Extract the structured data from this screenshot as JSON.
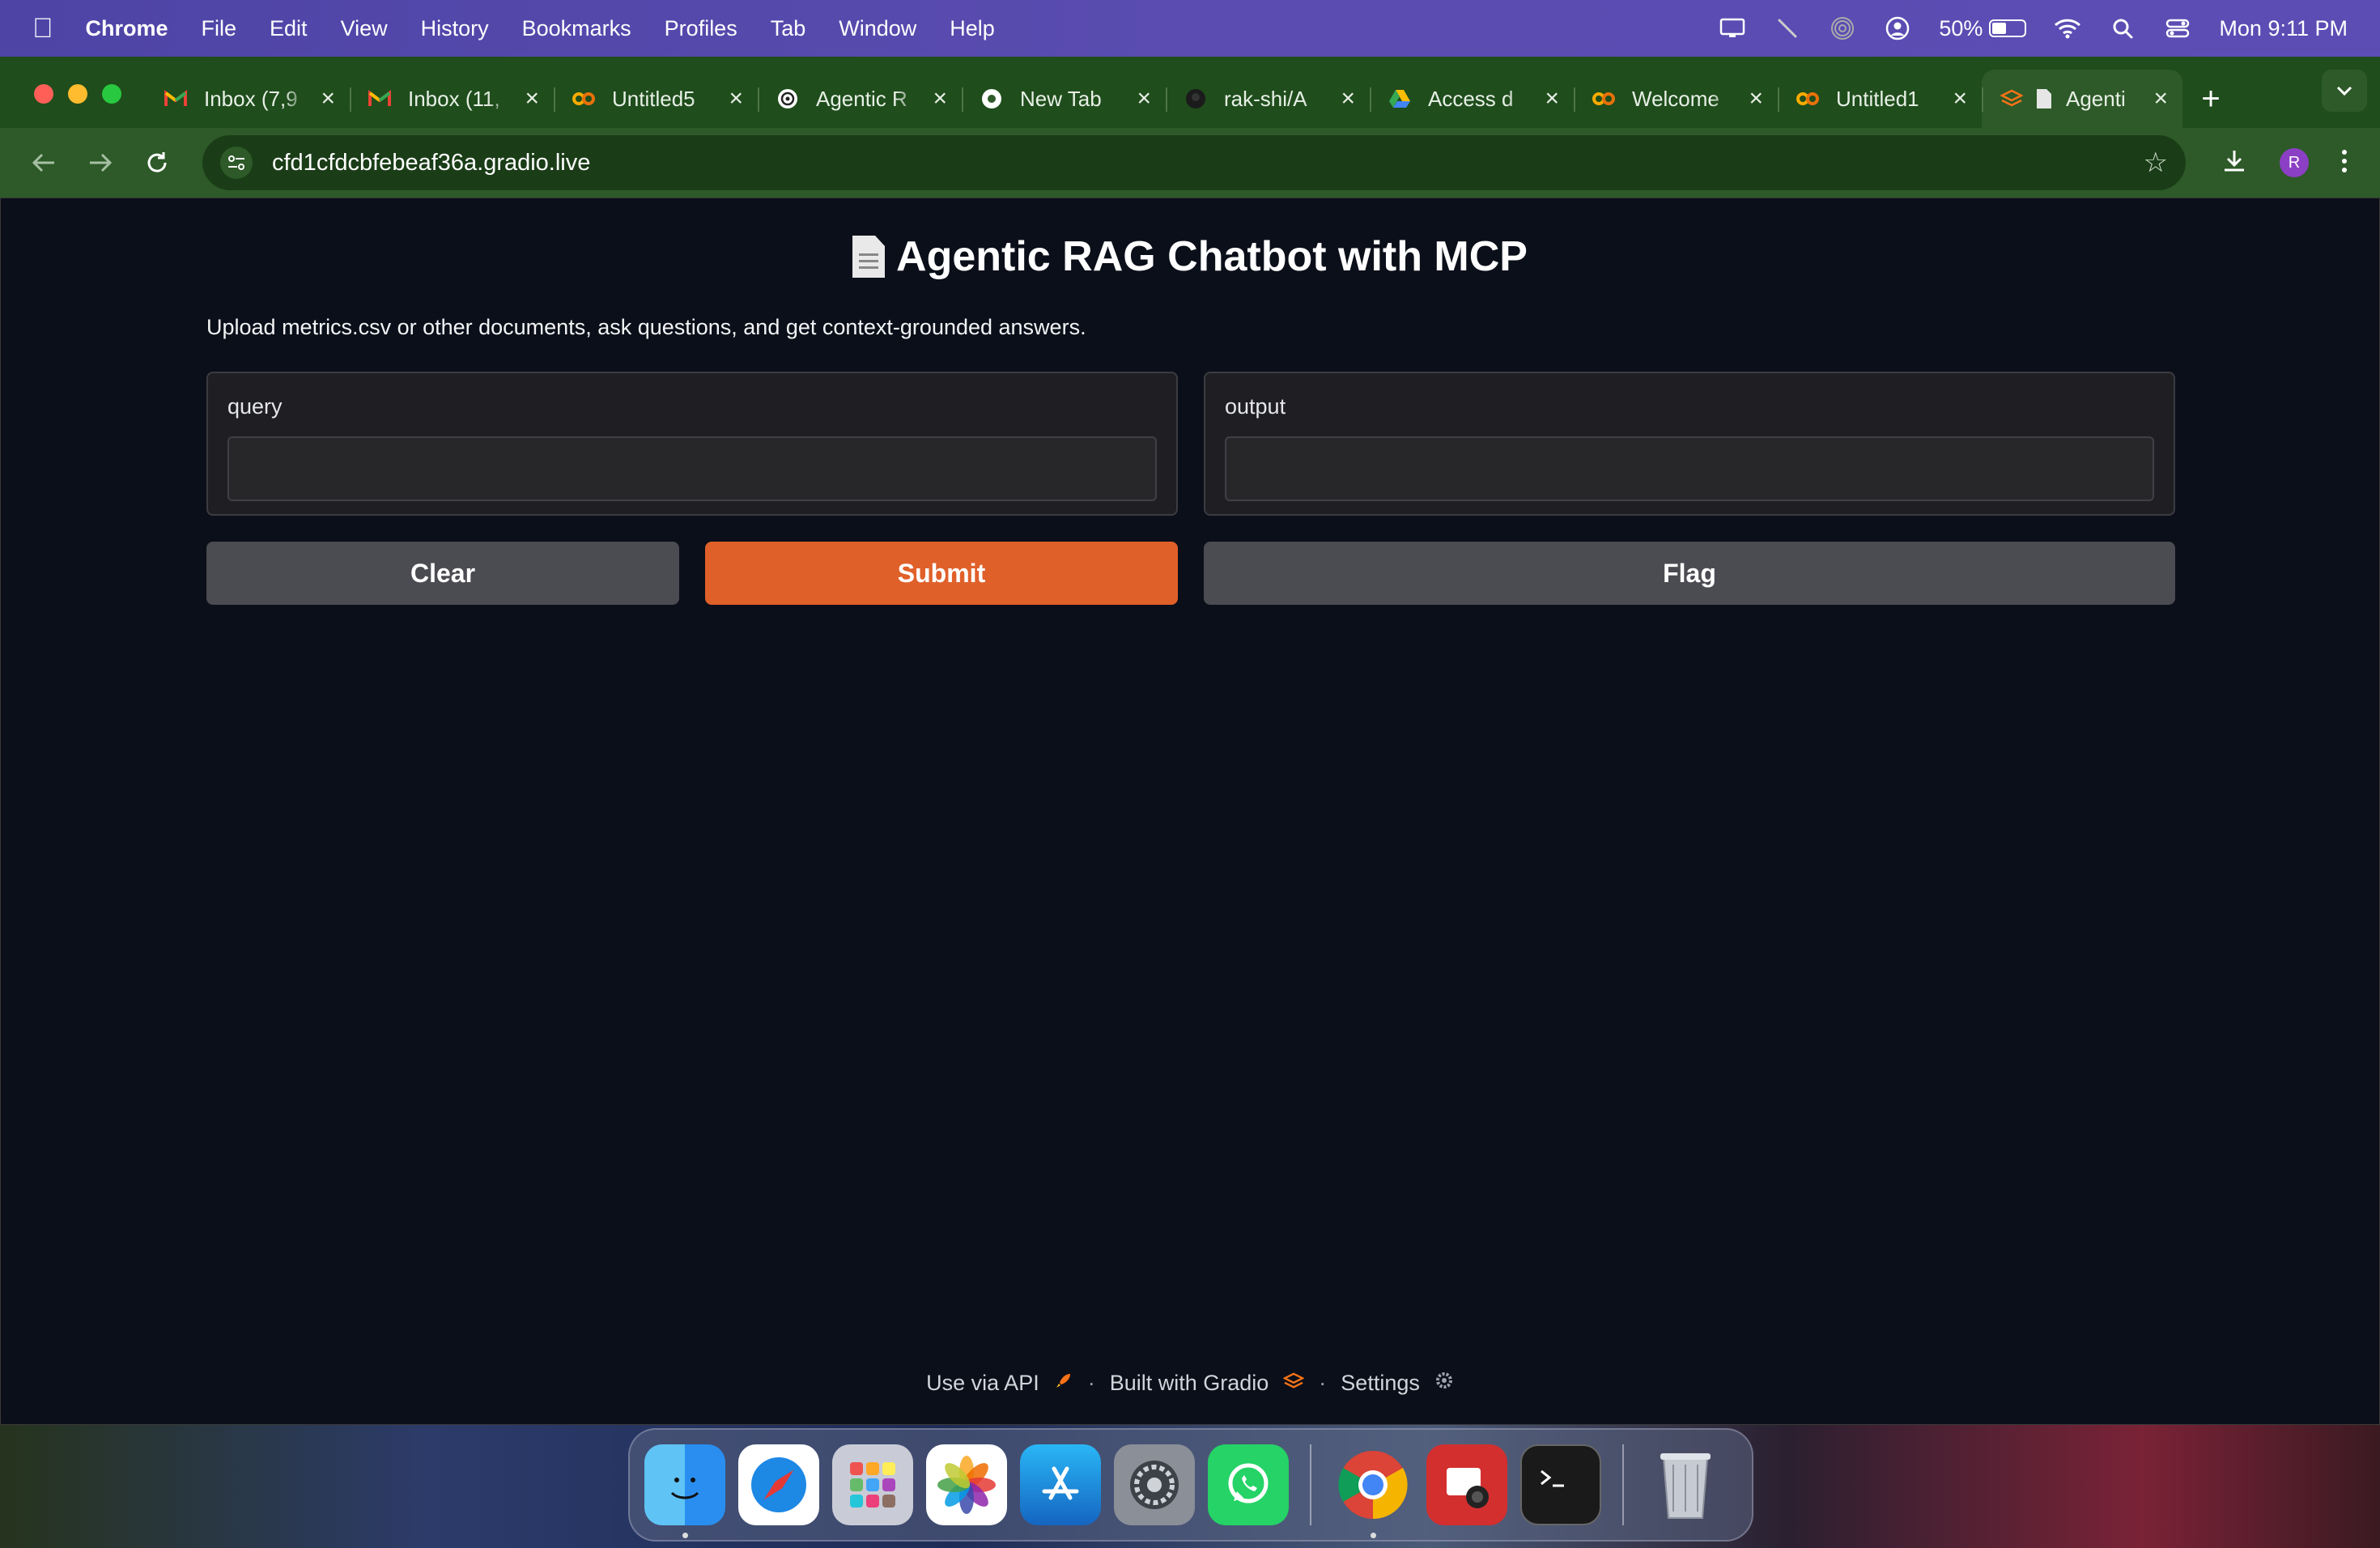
{
  "menubar": {
    "app_name": "Chrome",
    "menus": [
      "File",
      "Edit",
      "View",
      "History",
      "Bookmarks",
      "Profiles",
      "Tab",
      "Window",
      "Help"
    ],
    "battery_percent": "50%",
    "battery_level": 0.5,
    "clock": "Mon 9:11 PM"
  },
  "tabs": [
    {
      "title": "Inbox (7,9",
      "icon": "gmail-icon"
    },
    {
      "title": "Inbox (11,",
      "icon": "gmail-icon"
    },
    {
      "title": "Untitled5",
      "icon": "colab-icon"
    },
    {
      "title": "Agentic R",
      "icon": "openai-icon"
    },
    {
      "title": "New Tab",
      "icon": "chrome-icon"
    },
    {
      "title": "rak-shi/A",
      "icon": "github-icon"
    },
    {
      "title": "Access d",
      "icon": "drive-icon"
    },
    {
      "title": "Welcome",
      "icon": "colab-icon"
    },
    {
      "title": "Untitled1",
      "icon": "colab-icon"
    },
    {
      "title": "Agenti",
      "icon": "gradio-icon",
      "active": true
    }
  ],
  "toolbar": {
    "url": "cfd1cfdcbfebeaf36a.gradio.live",
    "profile_initial": "R"
  },
  "page": {
    "title": "Agentic RAG Chatbot with MCP",
    "subtitle": "Upload metrics.csv or other documents, ask questions, and get context-grounded answers.",
    "query_label": "query",
    "query_value": "",
    "output_label": "output",
    "output_value": "",
    "clear_label": "Clear",
    "submit_label": "Submit",
    "flag_label": "Flag"
  },
  "footer": {
    "api_label": "Use via API",
    "built_label": "Built with Gradio",
    "settings_label": "Settings"
  },
  "dock": [
    "Finder",
    "Safari",
    "Launchpad",
    "Photos",
    "App Store",
    "System Settings",
    "WhatsApp",
    "Google Chrome",
    "Photo Booth",
    "Terminal",
    "Trash"
  ],
  "colors": {
    "menubar": "#5a4cb0",
    "chrome_frame": "#2d5a28",
    "page_bg": "#0b0f19",
    "primary_button": "#e0602a",
    "secondary_button": "#4b4b52"
  }
}
